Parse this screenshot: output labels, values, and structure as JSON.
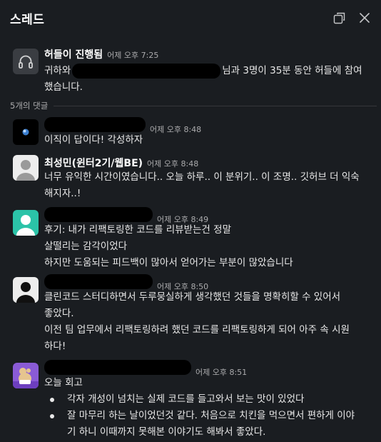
{
  "header": {
    "title": "스레드",
    "icons": [
      "open-in-window-icon",
      "close-icon"
    ]
  },
  "huddle": {
    "name": "허들이 진행됨",
    "time": "어제 오후 7:25",
    "line1_prefix": "귀하와",
    "line1_suffix": "님과 3명이 35분 동안 허들에 참여",
    "line2": "했습니다."
  },
  "replies_label": "5개의 댓글",
  "messages": [
    {
      "time": "어제 오후 8:48",
      "lines": [
        "이직이 답이다! 각성하자"
      ]
    },
    {
      "name": "최성민(윈터2기/웹BE)",
      "time": "어제 오후 8:48",
      "lines": [
        "너무 유익한 시간이였습니다.. 오늘 하루.. 이 분위기.. 이 조명.. 깃허브 더 익숙",
        "해지자..!"
      ]
    },
    {
      "time": "어제 오후 8:49",
      "lines": [
        "후기: 내가 리팩토링한 코드를 리뷰받는건 정말",
        "살떨리는 감각이었다",
        "하지만 도움되는 피드백이 많아서 얻어가는 부분이 많았습니다"
      ]
    },
    {
      "time": "어제 오후 8:50",
      "lines": [
        "클린코드 스터디하면서 두루뭉실하게 생각했던 것들을 명확히할 수 있어서",
        "좋았다.",
        "이전 팀 업무에서 리팩토링하려 했던 코드를 리팩토링하게 되어 아주 속 시원",
        "하다!"
      ]
    },
    {
      "time": "어제 오후 8:51",
      "intro": "오늘 회고",
      "bullets": [
        {
          "lines": [
            "각자 개성이 넘치는 실제 코드를 들고와서 보는 맛이 있었다"
          ]
        },
        {
          "lines": [
            "잘 마무리 하는 날이었던것 같다. 처음으로 치킨을 먹으면서 편하게 이야",
            "기 하니 이때까지 못해본 이야기도 해봐서 좋았다."
          ]
        }
      ]
    }
  ],
  "colors": {
    "background": "#1a1d21",
    "text": "#e8e8e8",
    "muted": "#ababad",
    "teal_avatar": "#2bc3a8",
    "purple_avatar": "#8a5bd6"
  }
}
